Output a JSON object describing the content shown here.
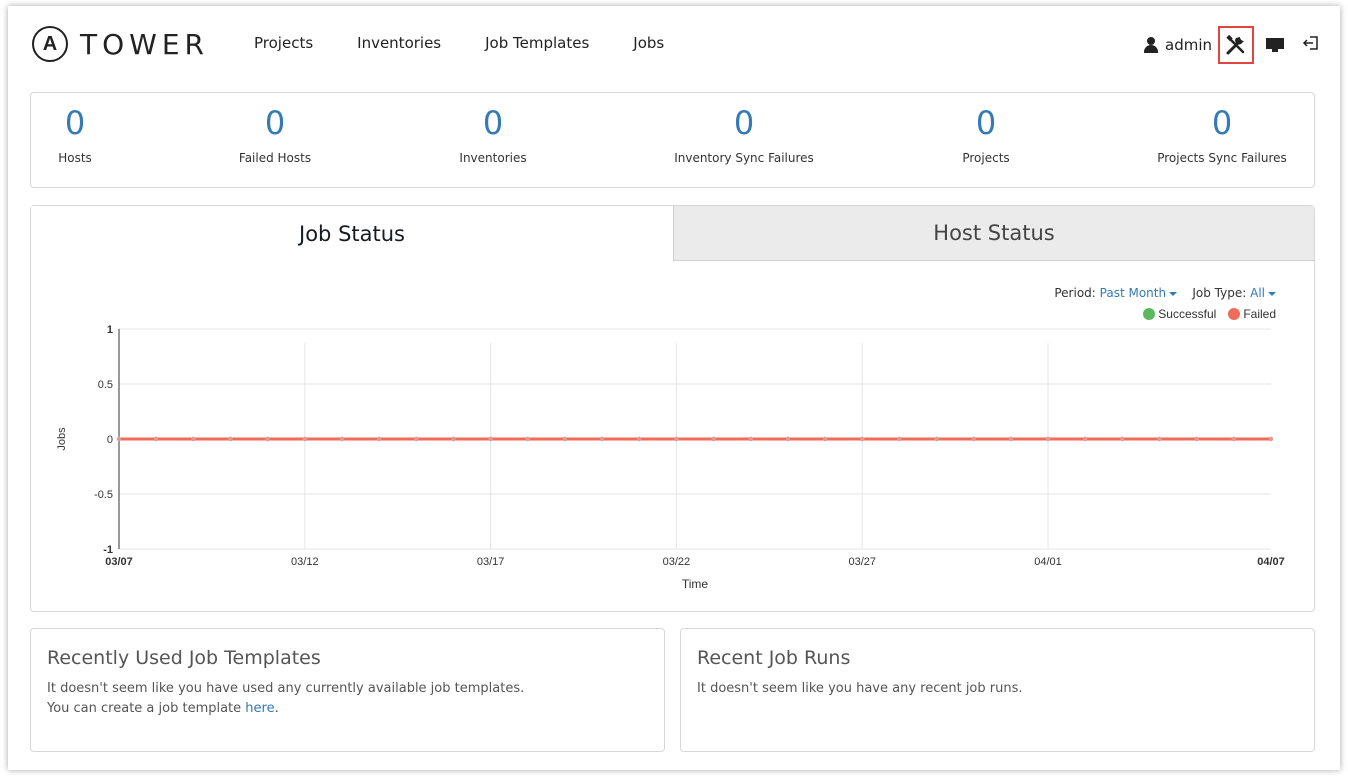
{
  "header": {
    "logo_text": "TOWER",
    "logo_mark": "A",
    "nav": [
      "Projects",
      "Inventories",
      "Job Templates",
      "Jobs"
    ],
    "username": "admin",
    "icons": [
      "user-icon",
      "tools-icon",
      "monitor-icon",
      "logout-icon"
    ]
  },
  "stats": [
    {
      "value": "0",
      "label": "Hosts"
    },
    {
      "value": "0",
      "label": "Failed Hosts"
    },
    {
      "value": "0",
      "label": "Inventories"
    },
    {
      "value": "0",
      "label": "Inventory Sync Failures"
    },
    {
      "value": "0",
      "label": "Projects"
    },
    {
      "value": "0",
      "label": "Projects Sync Failures"
    }
  ],
  "tabs": {
    "job_status": "Job Status",
    "host_status": "Host Status"
  },
  "filters": {
    "period_label": "Period:",
    "period_value": "Past Month",
    "job_type_label": "Job Type:",
    "job_type_value": "All"
  },
  "colors": {
    "successful": "#5cb85c",
    "failed": "#ef6b5a",
    "accent": "#337ab7",
    "highlight": "#e0453f"
  },
  "chart_data": {
    "type": "line",
    "ylabel": "Jobs",
    "xlabel": "Time",
    "ylim": [
      -1,
      1
    ],
    "yticks": [
      "1",
      "0.5",
      "0",
      "-0.5",
      "-1"
    ],
    "xticks": [
      "03/07",
      "03/12",
      "03/17",
      "03/22",
      "03/27",
      "04/01",
      "04/07"
    ],
    "x": [
      "03/07",
      "03/08",
      "03/09",
      "03/10",
      "03/11",
      "03/12",
      "03/13",
      "03/14",
      "03/15",
      "03/16",
      "03/17",
      "03/18",
      "03/19",
      "03/20",
      "03/21",
      "03/22",
      "03/23",
      "03/24",
      "03/25",
      "03/26",
      "03/27",
      "03/28",
      "03/29",
      "03/30",
      "03/31",
      "04/01",
      "04/02",
      "04/03",
      "04/04",
      "04/05",
      "04/06",
      "04/07"
    ],
    "series": [
      {
        "name": "Successful",
        "values": [
          0,
          0,
          0,
          0,
          0,
          0,
          0,
          0,
          0,
          0,
          0,
          0,
          0,
          0,
          0,
          0,
          0,
          0,
          0,
          0,
          0,
          0,
          0,
          0,
          0,
          0,
          0,
          0,
          0,
          0,
          0,
          0
        ]
      },
      {
        "name": "Failed",
        "values": [
          0,
          0,
          0,
          0,
          0,
          0,
          0,
          0,
          0,
          0,
          0,
          0,
          0,
          0,
          0,
          0,
          0,
          0,
          0,
          0,
          0,
          0,
          0,
          0,
          0,
          0,
          0,
          0,
          0,
          0,
          0,
          0
        ]
      }
    ],
    "grid": true,
    "legend": "top-right"
  },
  "recent_templates": {
    "title": "Recently Used Job Templates",
    "line1": "It doesn't seem like you have used any currently available job templates.",
    "line2_prefix": "You can create a job template",
    "link": "here",
    "line2_suffix": "."
  },
  "recent_runs": {
    "title": "Recent Job Runs",
    "text": "It doesn't seem like you have any recent job runs."
  }
}
